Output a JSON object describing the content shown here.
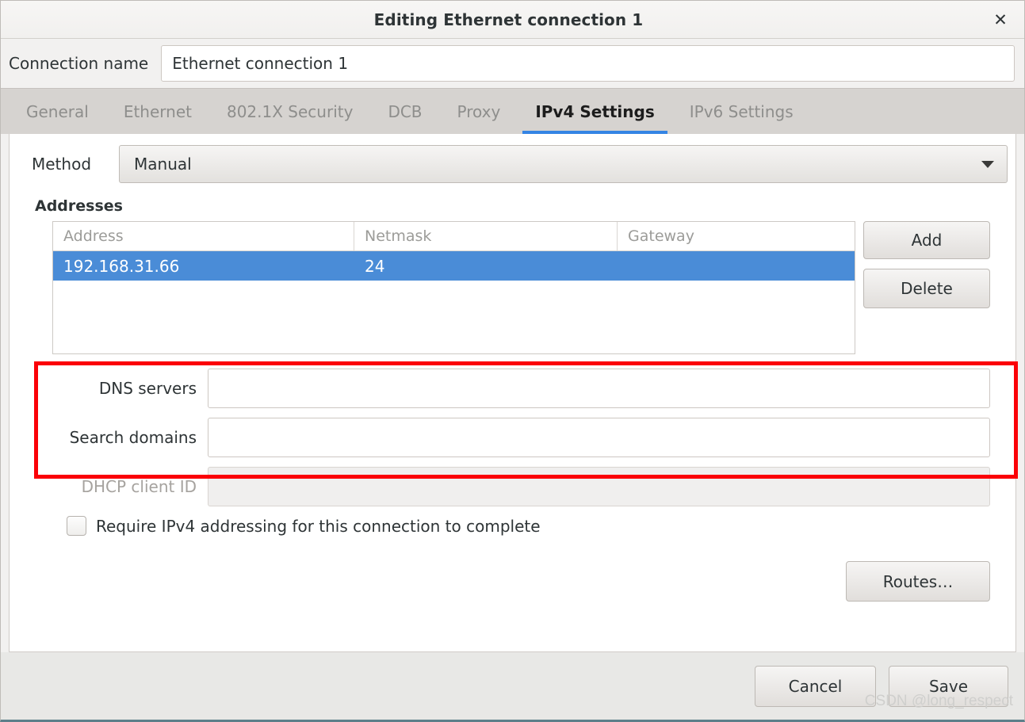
{
  "window": {
    "title": "Editing Ethernet connection 1",
    "close_icon": "close-icon",
    "close_glyph": "✕"
  },
  "connection": {
    "label": "Connection name",
    "value": "Ethernet connection 1",
    "placeholder": ""
  },
  "tabs": [
    {
      "label": "General",
      "active": false
    },
    {
      "label": "Ethernet",
      "active": false
    },
    {
      "label": "802.1X Security",
      "active": false
    },
    {
      "label": "DCB",
      "active": false
    },
    {
      "label": "Proxy",
      "active": false
    },
    {
      "label": "IPv4 Settings",
      "active": true
    },
    {
      "label": "IPv6 Settings",
      "active": false
    }
  ],
  "method": {
    "label": "Method",
    "value": "Manual",
    "caret_icon": "chevron-down-icon"
  },
  "addresses": {
    "title": "Addresses",
    "columns": [
      "Address",
      "Netmask",
      "Gateway"
    ],
    "rows": [
      {
        "address": "192.168.31.66",
        "netmask": "24",
        "gateway": "",
        "selected": true
      }
    ],
    "add_label": "Add",
    "delete_label": "Delete"
  },
  "fields": {
    "dns_label": "DNS servers",
    "dns_value": "",
    "search_label": "Search domains",
    "search_value": "",
    "dhcp_label": "DHCP client ID",
    "dhcp_value": ""
  },
  "require_ipv4": {
    "label": "Require IPv4 addressing for this connection to complete",
    "checked": false
  },
  "routes": {
    "label": "Routes…"
  },
  "footer": {
    "cancel_label": "Cancel",
    "save_label": "Save"
  },
  "watermark": {
    "text": "CSDN @long_respect"
  },
  "colors": {
    "accent": "#3584e4",
    "selection": "#4a8cd7",
    "highlight_box": "#fb0007",
    "window_bg": "#f2f1f0",
    "tabbar_bg": "#d6d3d0",
    "footer_bg": "#e8e8e6"
  }
}
